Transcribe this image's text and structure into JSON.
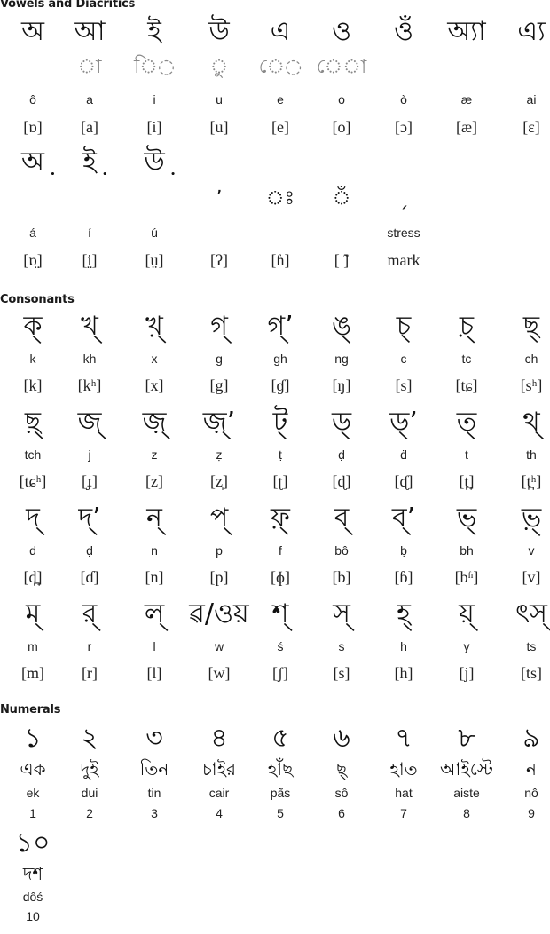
{
  "vowels": {
    "heading": "Vowels and Diacritics",
    "letters": [
      "অ",
      "আ",
      "ই",
      "উ",
      "এ",
      "ও",
      "ওঁ",
      "অ্যা",
      "এ্য"
    ],
    "diacritics": [
      "",
      "◌া",
      "ি◌",
      "◌ু",
      "ে◌",
      "ে◌া",
      "",
      "",
      ""
    ],
    "latin": [
      "ô",
      "a",
      "i",
      "u",
      "e",
      "o",
      "ò",
      "æ",
      "ai"
    ],
    "ipa": [
      "[ɒ]",
      "[a]",
      "[i]",
      "[u]",
      "[e]",
      "[o]",
      "[ɔ]",
      "[æ]",
      "[ɛ]"
    ],
    "letters2": [
      "অ়",
      "ই়",
      "উ়",
      "",
      "",
      "",
      "",
      "",
      ""
    ],
    "diacritics2": [
      "",
      "",
      "",
      "ʼ",
      "◌ঃ",
      "◌ঁ",
      "ˏ",
      "",
      ""
    ],
    "latin2": [
      "á",
      "í",
      "ú",
      "",
      "",
      "",
      "stress",
      "",
      ""
    ],
    "ipa2": [
      "[ɒ̤]",
      "[i̤]",
      "[ṳ]",
      "[ʔ]",
      "[ɦ]",
      "[ ̃]",
      "mark",
      "",
      ""
    ]
  },
  "consonants": {
    "heading": "Consonants",
    "rows": [
      {
        "letters": [
          "ক্",
          "খ্",
          "খ়্",
          "গ্",
          "গ্ʼ",
          "ঙ্",
          "চ্",
          "চ়্",
          "ছ্"
        ],
        "latin": [
          "k",
          "kh",
          "x",
          "g",
          "gh",
          "ng",
          "c",
          "tc",
          "ch"
        ],
        "ipa": [
          "[k]",
          "[kʰ]",
          "[x]",
          "[g]",
          "[ɠ]",
          "[ŋ]",
          "[s]",
          "[tɕ]",
          "[sʰ]"
        ]
      },
      {
        "letters": [
          "ছ়্",
          "জ্",
          "জ়্",
          "জ়্ʼ",
          "ট্",
          "ড্",
          "ড্ʼ",
          "ত্",
          "থ্"
        ],
        "latin": [
          "tch",
          "j",
          "z",
          "ẓ",
          "ṭ",
          "ḍ",
          "ḋ",
          "t",
          "th"
        ],
        "ipa": [
          "[tɕʰ]",
          "[ɟ]",
          "[z]",
          "[z̩]",
          "[ʈ]",
          "[ɖ]",
          "[ᶑ]",
          "[t̪]",
          "[t̪ʰ]"
        ]
      },
      {
        "letters": [
          "দ্",
          "দ্ʼ",
          "ন্",
          "প্",
          "ফ়্",
          "ব্",
          "ব্ʼ",
          "ভ্",
          "ভ়্"
        ],
        "latin": [
          "d",
          "ḍ",
          "n",
          "p",
          "f",
          "bô",
          "ḅ",
          "bh",
          "v"
        ],
        "ipa": [
          "[d̪]",
          "[ɗ]",
          "[n]",
          "[p]",
          "[ɸ]",
          "[b]",
          "[ɓ]",
          "[bʱ]",
          "[v]"
        ]
      },
      {
        "letters": [
          "ম্",
          "র্",
          "ল্",
          "ৱ/ওয়",
          "শ্",
          "স্",
          "হ্",
          "য়্",
          "ৎস্"
        ],
        "latin": [
          "m",
          "r",
          "l",
          "w",
          "ś",
          "s",
          "h",
          "y",
          "ts"
        ],
        "ipa": [
          "[m]",
          "[r]",
          "[l]",
          "[w]",
          "[ʃ]",
          "[s]",
          "[h]",
          "[j]",
          "[ts]"
        ]
      }
    ]
  },
  "numerals": {
    "heading": "Numerals",
    "digits": [
      "১",
      "২",
      "৩",
      "৪",
      "৫",
      "৬",
      "৭",
      "৮",
      "৯"
    ],
    "words": [
      "এক",
      "দুই",
      "তিন",
      "চাইর",
      "হাঁছ",
      "ছ্",
      "হাত",
      "আইস্টে",
      "ন"
    ],
    "latin": [
      "ek",
      "dui",
      "tin",
      "cair",
      "pãs",
      "sô",
      "hat",
      "aiste",
      "nô"
    ],
    "values": [
      "1",
      "2",
      "3",
      "4",
      "5",
      "6",
      "7",
      "8",
      "9"
    ],
    "ten": {
      "digit": "১০",
      "word": "দশ",
      "latin": "dôś",
      "value": "10"
    }
  }
}
